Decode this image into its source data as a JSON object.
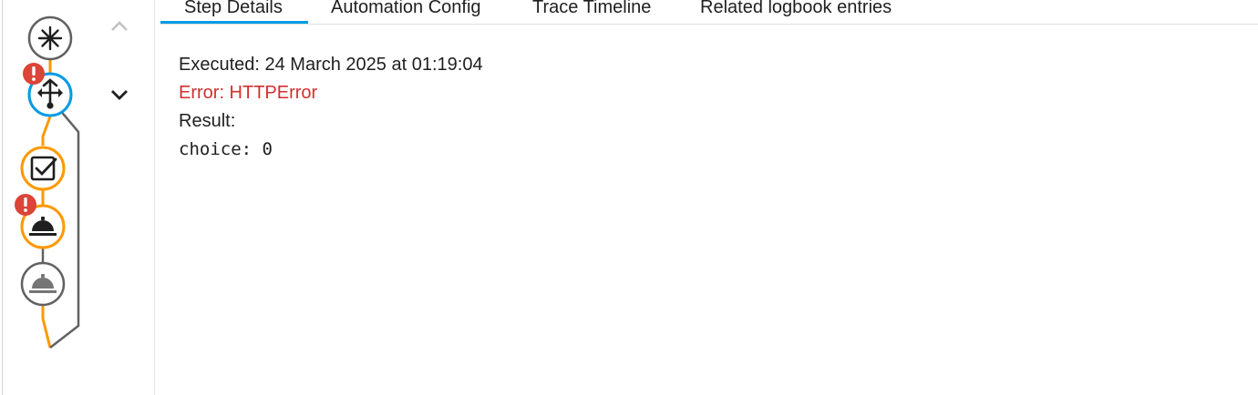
{
  "tabs": [
    {
      "label": "Step Details",
      "active": true
    },
    {
      "label": "Automation Config",
      "active": false
    },
    {
      "label": "Trace Timeline",
      "active": false
    },
    {
      "label": "Related logbook entries",
      "active": false
    }
  ],
  "details": {
    "executed": "Executed: 24 March 2025 at 01:19:04",
    "error": "Error: HTTPError",
    "result_label": "Result:",
    "result_value": "choice: 0"
  },
  "graph": {
    "nodes": [
      {
        "icon": "asterisk-icon",
        "state": "default"
      },
      {
        "icon": "source-branch-icon",
        "state": "active",
        "error": true
      },
      {
        "icon": "check-box-icon",
        "state": "executed"
      },
      {
        "icon": "room-service-icon",
        "state": "executed",
        "error": true
      },
      {
        "icon": "room-service-icon",
        "state": "not-executed"
      }
    ]
  },
  "colors": {
    "accent": "#039be5",
    "executed": "#ff9800",
    "default": "#616161",
    "error": "#d32f2f"
  }
}
